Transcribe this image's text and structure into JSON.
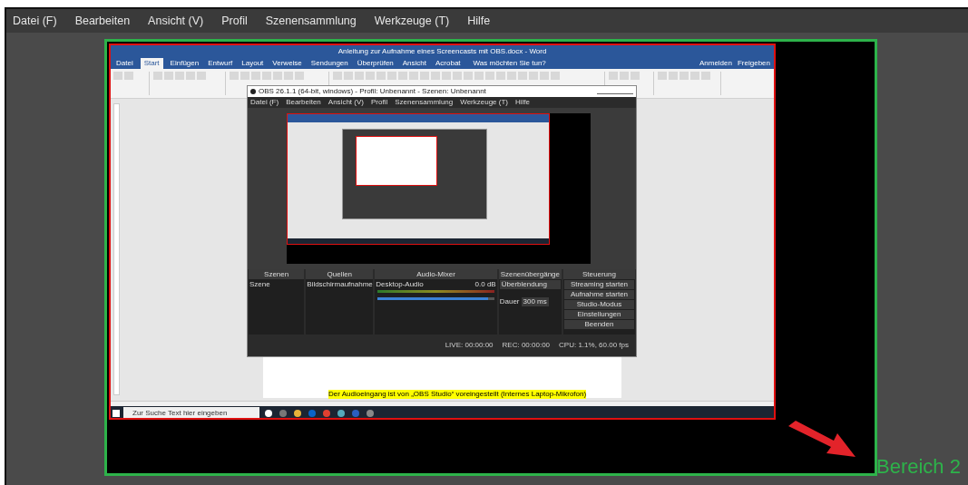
{
  "menu": [
    "Datei (F)",
    "Bearbeiten",
    "Ansicht (V)",
    "Profil",
    "Szenensammlung",
    "Werkzeuge (T)",
    "Hilfe"
  ],
  "preview": {
    "label": "Bereich 2",
    "word": {
      "title": "Anleitung zur Aufnahme eines Screencasts mit OBS.docx - Word",
      "tabs": [
        {
          "label": "Datei",
          "selected": false
        },
        {
          "label": "Start",
          "selected": true
        },
        {
          "label": "Einfügen",
          "selected": false
        },
        {
          "label": "Entwurf",
          "selected": false
        },
        {
          "label": "Layout",
          "selected": false
        },
        {
          "label": "Verweise",
          "selected": false
        },
        {
          "label": "Sendungen",
          "selected": false
        },
        {
          "label": "Überprüfen",
          "selected": false
        },
        {
          "label": "Ansicht",
          "selected": false
        },
        {
          "label": "Acrobat",
          "selected": false
        }
      ],
      "tell_me": "Was möchten Sie tun?",
      "account": [
        "Anmelden",
        "Freigeben"
      ],
      "document_line": "Der Audioeingang ist von „OBS Studio“ voreingestellt (Internes Laptop-Mikrofon)",
      "taskbar_search": "Zur Suche Text hier eingeben"
    },
    "obs": {
      "title": "OBS 26.1.1 (64-bit, windows) - Profil: Unbenannt - Szenen: Unbenannt",
      "menu": [
        "Datei (F)",
        "Bearbeiten",
        "Ansicht (V)",
        "Profil",
        "Szenensammlung",
        "Werkzeuge (T)",
        "Hilfe"
      ],
      "docks": [
        "Szenen",
        "Quellen",
        "Audio-Mixer",
        "Szenenübergänge",
        "Steuerung"
      ],
      "scenes": [
        "Szene"
      ],
      "sources": [
        "Bildschirmaufnahme"
      ],
      "audio": {
        "name": "Desktop-Audio",
        "reading": "0.0 dB",
        "level": 0.95
      },
      "transition": "Überblendung",
      "duration_label": "Dauer",
      "duration": "300 ms",
      "controls": [
        "Streaming starten",
        "Aufnahme starten",
        "Studio-Modus",
        "Einstellungen",
        "Beenden"
      ],
      "status": [
        "LIVE: 00:00:00",
        "REC: 00:00:00",
        "CPU: 1.1%, 60.00 fps"
      ]
    }
  }
}
